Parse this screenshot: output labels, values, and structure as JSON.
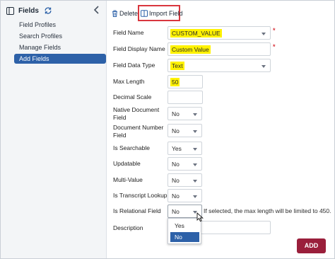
{
  "sidebar": {
    "title": "Fields",
    "items": [
      {
        "label": "Field Profiles"
      },
      {
        "label": "Search Profiles"
      },
      {
        "label": "Manage Fields"
      },
      {
        "label": "Add Fields"
      }
    ],
    "active_color": "#2d61a8"
  },
  "toolbar": {
    "delete_label": "Delete",
    "import_label": "Import Field",
    "highlight_color": "#d9363e"
  },
  "form": {
    "field_name": {
      "label": "Field Name",
      "value": "CUSTOM_VALUE"
    },
    "field_display_name": {
      "label": "Field Display Name",
      "value": "Custom Value"
    },
    "field_data_type": {
      "label": "Field Data Type",
      "value": "Text"
    },
    "max_length": {
      "label": "Max Length",
      "value": "50"
    },
    "decimal_scale": {
      "label": "Decimal Scale",
      "value": ""
    },
    "native_document_field": {
      "label_line1": "Native Document",
      "label_line2": "Field",
      "value": "No"
    },
    "document_number_field": {
      "label_line1": "Document Number",
      "label_line2": "Field",
      "value": "No"
    },
    "is_searchable": {
      "label": "Is Searchable",
      "value": "Yes"
    },
    "updatable": {
      "label": "Updatable",
      "value": "No"
    },
    "multi_value": {
      "label": "Multi-Value",
      "value": "No"
    },
    "is_transcript_lookup": {
      "label": "Is Transcript Lookup",
      "value": "No"
    },
    "is_relational_field": {
      "label": "Is Relational Field",
      "value": "No",
      "hint": "If selected, the max length will be limited to 450.",
      "options": [
        "Yes",
        "No"
      ],
      "highlighted_option": "No"
    },
    "description": {
      "label": "Description",
      "value": ""
    },
    "required_marker": "*",
    "highlight_color": "#fff200"
  },
  "actions": {
    "add_label": "ADD",
    "add_color": "#9a1f3b"
  }
}
